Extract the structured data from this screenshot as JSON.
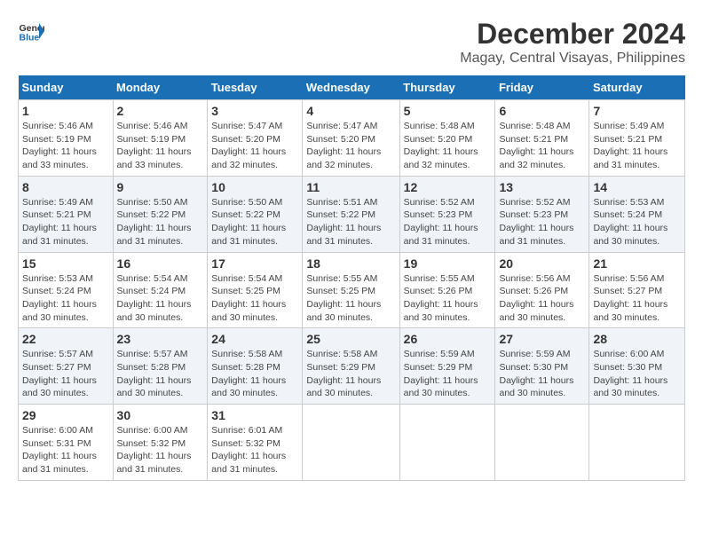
{
  "logo": {
    "text_general": "General",
    "text_blue": "Blue"
  },
  "title": {
    "month": "December 2024",
    "location": "Magay, Central Visayas, Philippines"
  },
  "weekdays": [
    "Sunday",
    "Monday",
    "Tuesday",
    "Wednesday",
    "Thursday",
    "Friday",
    "Saturday"
  ],
  "days": [
    {
      "date": "",
      "info": ""
    },
    {
      "date": "1",
      "sunrise": "Sunrise: 5:46 AM",
      "sunset": "Sunset: 5:19 PM",
      "daylight": "Daylight: 11 hours and 33 minutes."
    },
    {
      "date": "2",
      "sunrise": "Sunrise: 5:46 AM",
      "sunset": "Sunset: 5:19 PM",
      "daylight": "Daylight: 11 hours and 33 minutes."
    },
    {
      "date": "3",
      "sunrise": "Sunrise: 5:47 AM",
      "sunset": "Sunset: 5:20 PM",
      "daylight": "Daylight: 11 hours and 32 minutes."
    },
    {
      "date": "4",
      "sunrise": "Sunrise: 5:47 AM",
      "sunset": "Sunset: 5:20 PM",
      "daylight": "Daylight: 11 hours and 32 minutes."
    },
    {
      "date": "5",
      "sunrise": "Sunrise: 5:48 AM",
      "sunset": "Sunset: 5:20 PM",
      "daylight": "Daylight: 11 hours and 32 minutes."
    },
    {
      "date": "6",
      "sunrise": "Sunrise: 5:48 AM",
      "sunset": "Sunset: 5:21 PM",
      "daylight": "Daylight: 11 hours and 32 minutes."
    },
    {
      "date": "7",
      "sunrise": "Sunrise: 5:49 AM",
      "sunset": "Sunset: 5:21 PM",
      "daylight": "Daylight: 11 hours and 31 minutes."
    },
    {
      "date": "8",
      "sunrise": "Sunrise: 5:49 AM",
      "sunset": "Sunset: 5:21 PM",
      "daylight": "Daylight: 11 hours and 31 minutes."
    },
    {
      "date": "9",
      "sunrise": "Sunrise: 5:50 AM",
      "sunset": "Sunset: 5:22 PM",
      "daylight": "Daylight: 11 hours and 31 minutes."
    },
    {
      "date": "10",
      "sunrise": "Sunrise: 5:50 AM",
      "sunset": "Sunset: 5:22 PM",
      "daylight": "Daylight: 11 hours and 31 minutes."
    },
    {
      "date": "11",
      "sunrise": "Sunrise: 5:51 AM",
      "sunset": "Sunset: 5:22 PM",
      "daylight": "Daylight: 11 hours and 31 minutes."
    },
    {
      "date": "12",
      "sunrise": "Sunrise: 5:52 AM",
      "sunset": "Sunset: 5:23 PM",
      "daylight": "Daylight: 11 hours and 31 minutes."
    },
    {
      "date": "13",
      "sunrise": "Sunrise: 5:52 AM",
      "sunset": "Sunset: 5:23 PM",
      "daylight": "Daylight: 11 hours and 31 minutes."
    },
    {
      "date": "14",
      "sunrise": "Sunrise: 5:53 AM",
      "sunset": "Sunset: 5:24 PM",
      "daylight": "Daylight: 11 hours and 30 minutes."
    },
    {
      "date": "15",
      "sunrise": "Sunrise: 5:53 AM",
      "sunset": "Sunset: 5:24 PM",
      "daylight": "Daylight: 11 hours and 30 minutes."
    },
    {
      "date": "16",
      "sunrise": "Sunrise: 5:54 AM",
      "sunset": "Sunset: 5:24 PM",
      "daylight": "Daylight: 11 hours and 30 minutes."
    },
    {
      "date": "17",
      "sunrise": "Sunrise: 5:54 AM",
      "sunset": "Sunset: 5:25 PM",
      "daylight": "Daylight: 11 hours and 30 minutes."
    },
    {
      "date": "18",
      "sunrise": "Sunrise: 5:55 AM",
      "sunset": "Sunset: 5:25 PM",
      "daylight": "Daylight: 11 hours and 30 minutes."
    },
    {
      "date": "19",
      "sunrise": "Sunrise: 5:55 AM",
      "sunset": "Sunset: 5:26 PM",
      "daylight": "Daylight: 11 hours and 30 minutes."
    },
    {
      "date": "20",
      "sunrise": "Sunrise: 5:56 AM",
      "sunset": "Sunset: 5:26 PM",
      "daylight": "Daylight: 11 hours and 30 minutes."
    },
    {
      "date": "21",
      "sunrise": "Sunrise: 5:56 AM",
      "sunset": "Sunset: 5:27 PM",
      "daylight": "Daylight: 11 hours and 30 minutes."
    },
    {
      "date": "22",
      "sunrise": "Sunrise: 5:57 AM",
      "sunset": "Sunset: 5:27 PM",
      "daylight": "Daylight: 11 hours and 30 minutes."
    },
    {
      "date": "23",
      "sunrise": "Sunrise: 5:57 AM",
      "sunset": "Sunset: 5:28 PM",
      "daylight": "Daylight: 11 hours and 30 minutes."
    },
    {
      "date": "24",
      "sunrise": "Sunrise: 5:58 AM",
      "sunset": "Sunset: 5:28 PM",
      "daylight": "Daylight: 11 hours and 30 minutes."
    },
    {
      "date": "25",
      "sunrise": "Sunrise: 5:58 AM",
      "sunset": "Sunset: 5:29 PM",
      "daylight": "Daylight: 11 hours and 30 minutes."
    },
    {
      "date": "26",
      "sunrise": "Sunrise: 5:59 AM",
      "sunset": "Sunset: 5:29 PM",
      "daylight": "Daylight: 11 hours and 30 minutes."
    },
    {
      "date": "27",
      "sunrise": "Sunrise: 5:59 AM",
      "sunset": "Sunset: 5:30 PM",
      "daylight": "Daylight: 11 hours and 30 minutes."
    },
    {
      "date": "28",
      "sunrise": "Sunrise: 6:00 AM",
      "sunset": "Sunset: 5:30 PM",
      "daylight": "Daylight: 11 hours and 30 minutes."
    },
    {
      "date": "29",
      "sunrise": "Sunrise: 6:00 AM",
      "sunset": "Sunset: 5:31 PM",
      "daylight": "Daylight: 11 hours and 31 minutes."
    },
    {
      "date": "30",
      "sunrise": "Sunrise: 6:00 AM",
      "sunset": "Sunset: 5:32 PM",
      "daylight": "Daylight: 11 hours and 31 minutes."
    },
    {
      "date": "31",
      "sunrise": "Sunrise: 6:01 AM",
      "sunset": "Sunset: 5:32 PM",
      "daylight": "Daylight: 11 hours and 31 minutes."
    }
  ]
}
